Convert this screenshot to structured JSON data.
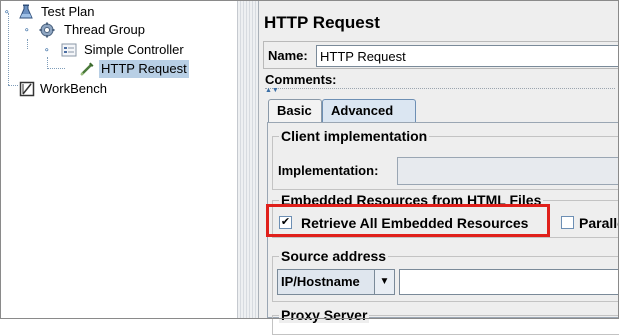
{
  "tree": {
    "items": [
      {
        "label": "Test Plan",
        "icon": "test-plan-icon"
      },
      {
        "label": "Thread Group",
        "icon": "gear-icon"
      },
      {
        "label": "Simple Controller",
        "icon": "controller-icon"
      },
      {
        "label": "HTTP Request",
        "icon": "pipette-icon",
        "selected": true
      },
      {
        "label": "WorkBench",
        "icon": "workbench-icon"
      }
    ],
    "expander_glyph": "•"
  },
  "panel": {
    "title": "HTTP Request",
    "name_label": "Name:",
    "name_value": "HTTP Request",
    "comments_label": "Comments:",
    "tabs": [
      {
        "label": "Basic",
        "active": false
      },
      {
        "label": "Advanced",
        "active": true
      }
    ],
    "client_impl": {
      "group_title": "Client implementation",
      "label": "Implementation:",
      "value": ""
    },
    "embedded": {
      "group_title": "Embedded Resources from HTML Files",
      "retrieve_label": "Retrieve All Embedded Resources",
      "retrieve_checked": true,
      "checkmark": "✔",
      "parallel_label": "Paralle",
      "parallel_checked": false
    },
    "source_address": {
      "group_title": "Source address",
      "type_value": "IP/Hostname",
      "dropdown_glyph": "▼",
      "address_value": ""
    },
    "proxy": {
      "group_title": "Proxy Server"
    }
  },
  "colors": {
    "highlight": "#e0201b",
    "selection": "#b8cfe5",
    "panel_bg": "#eeeeee"
  }
}
